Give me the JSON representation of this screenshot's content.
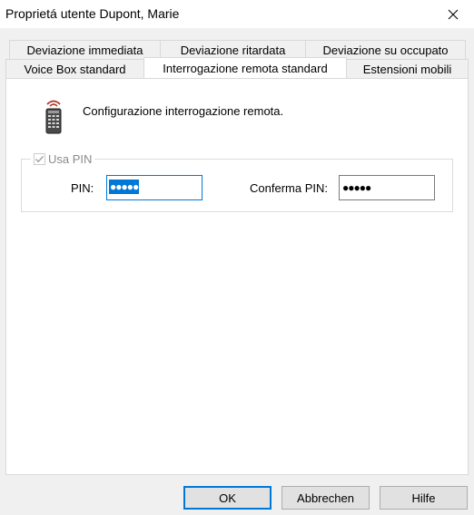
{
  "window": {
    "title": "Proprietá utente Dupont, Marie",
    "close_icon": "close-icon"
  },
  "tabs": {
    "row1": [
      {
        "label": "Deviazione immediata"
      },
      {
        "label": "Deviazione ritardata"
      },
      {
        "label": "Deviazione su occupato"
      }
    ],
    "row2": [
      {
        "label": "Voice Box standard"
      },
      {
        "label": "Interrogazione remota standard",
        "active": true
      },
      {
        "label": "Estensioni mobili"
      }
    ]
  },
  "content": {
    "icon": "remote-control-icon",
    "description": "Configurazione interrogazione remota.",
    "use_pin": {
      "label": "Usa PIN",
      "checked": true,
      "disabled": true
    },
    "pin": {
      "label": "PIN:",
      "value": "●●●●●"
    },
    "confirm_pin": {
      "label": "Conferma PIN:",
      "value": "●●●●●"
    }
  },
  "buttons": {
    "ok": "OK",
    "cancel": "Abbrechen",
    "help": "Hilfe"
  },
  "colors": {
    "accent": "#0078d7",
    "window_bg": "#f0f0f0",
    "panel_bg": "#ffffff",
    "button_bg": "#e1e1e1"
  }
}
